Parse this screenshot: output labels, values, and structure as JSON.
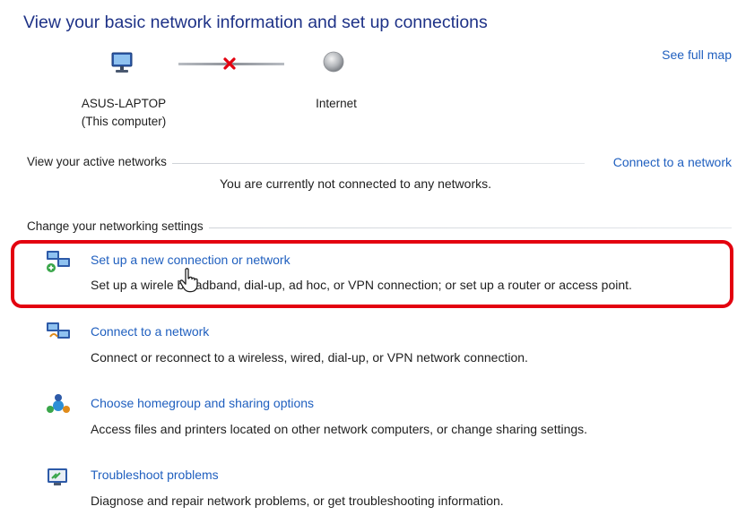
{
  "header": {
    "title": "View your basic network information and set up connections",
    "see_full_map": "See full map"
  },
  "network_map": {
    "computer_name": "ASUS-LAPTOP",
    "computer_sub": "(This computer)",
    "internet_label": "Internet",
    "computer_icon": "computer-icon",
    "status_icon": "disconnected-x-icon",
    "internet_icon": "globe-icon",
    "status_color": "#e3000f"
  },
  "active_networks": {
    "label": "View your active networks",
    "connect_link": "Connect to a network",
    "status": "You are currently not connected to any networks."
  },
  "settings": {
    "label": "Change your networking settings",
    "items": [
      {
        "icon": "new-connection-icon",
        "link": "Set up a new connection or network",
        "description": "Set up a wirele   broadband, dial-up, ad hoc, or VPN connection; or set up a router or access point."
      },
      {
        "icon": "connect-network-icon",
        "link": "Connect to a network",
        "description": "Connect or reconnect to a wireless, wired, dial-up, or VPN network connection."
      },
      {
        "icon": "homegroup-icon",
        "link": "Choose homegroup and sharing options",
        "description": "Access files and printers located on other network computers, or change sharing settings."
      },
      {
        "icon": "troubleshoot-icon",
        "link": "Troubleshoot problems",
        "description": "Diagnose and repair network problems, or get troubleshooting information."
      }
    ]
  },
  "colors": {
    "title": "#1e3287",
    "link": "#1f5fbf",
    "highlight": "#e3000f"
  }
}
